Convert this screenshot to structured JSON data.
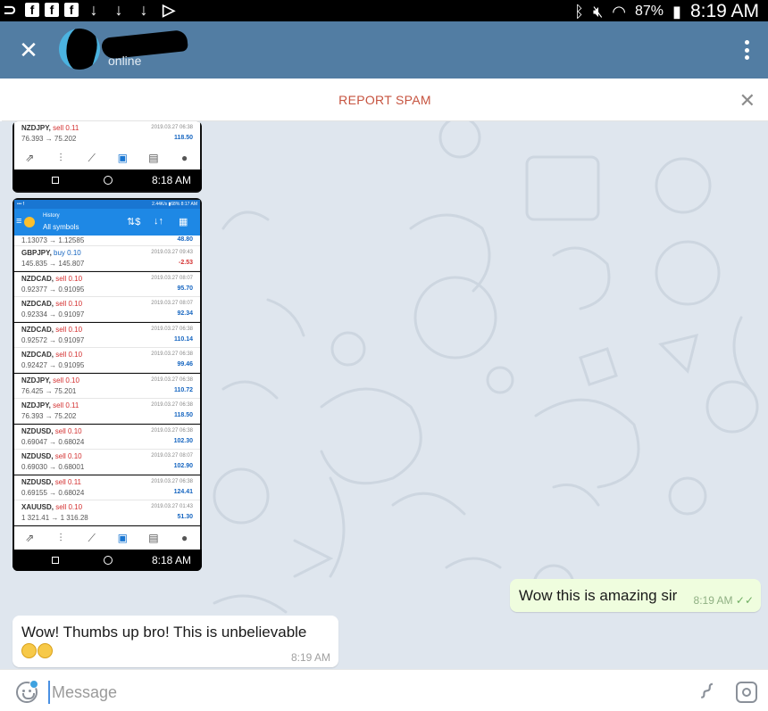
{
  "status_bar": {
    "battery": "87%",
    "time": "8:19 AM"
  },
  "header": {
    "close_icon": "close-icon",
    "status": "online",
    "menu_icon": "more-vertical-icon"
  },
  "spam_bar": {
    "label": "REPORT SPAM",
    "close_icon": "close-icon"
  },
  "photo_1": {
    "rows": [
      {
        "symbol": "NZDJPY,",
        "side": "sell 0.11",
        "prices": "76.393 → 75.202",
        "date": "2019.03.27 06:38",
        "profit": "118.50"
      }
    ],
    "nav_time": "8:18 AM"
  },
  "photo_2": {
    "status_left": "••• f",
    "status_right": "2.44K/s  ▮68% 8:17 AM",
    "title": "History",
    "subtitle": "All symbols",
    "partial_row": {
      "prices": "1.13073 → 1.12585",
      "profit": "48.80"
    },
    "rows": [
      {
        "symbol": "GBPJPY,",
        "side": "buy 0.10",
        "side_type": "buy",
        "prices": "145.835 → 145.807",
        "date": "2019.03.27 09:43",
        "profit": "-2.53",
        "neg": true
      },
      {
        "symbol": "NZDCAD,",
        "side": "sell 0.10",
        "side_type": "sell",
        "prices": "0.92377 → 0.91095",
        "date": "2019.03.27 08:07",
        "profit": "95.70",
        "neg": false
      },
      {
        "symbol": "NZDCAD,",
        "side": "sell 0.10",
        "side_type": "sell",
        "prices": "0.92334 → 0.91097",
        "date": "2019.03.27 08:07",
        "profit": "92.34",
        "neg": false
      },
      {
        "symbol": "NZDCAD,",
        "side": "sell 0.10",
        "side_type": "sell",
        "prices": "0.92572 → 0.91097",
        "date": "2019.03.27 06:38",
        "profit": "110.14",
        "neg": false
      },
      {
        "symbol": "NZDCAD,",
        "side": "sell 0.10",
        "side_type": "sell",
        "prices": "0.92427 → 0.91095",
        "date": "2019.03.27 06:38",
        "profit": "99.46",
        "neg": false
      },
      {
        "symbol": "NZDJPY,",
        "side": "sell 0.10",
        "side_type": "sell",
        "prices": "76.425 → 75.201",
        "date": "2019.03.27 06:38",
        "profit": "110.72",
        "neg": false
      },
      {
        "symbol": "NZDJPY,",
        "side": "sell 0.11",
        "side_type": "sell",
        "prices": "76.393 → 75.202",
        "date": "2019.03.27 06:38",
        "profit": "118.50",
        "neg": false
      },
      {
        "symbol": "NZDUSD,",
        "side": "sell 0.10",
        "side_type": "sell",
        "prices": "0.69047 → 0.68024",
        "date": "2019.03.27 06:38",
        "profit": "102.30",
        "neg": false
      },
      {
        "symbol": "NZDUSD,",
        "side": "sell 0.10",
        "side_type": "sell",
        "prices": "0.69030 → 0.68001",
        "date": "2019.03.27 08:07",
        "profit": "102.90",
        "neg": false
      },
      {
        "symbol": "NZDUSD,",
        "side": "sell 0.11",
        "side_type": "sell",
        "prices": "0.69155 → 0.68024",
        "date": "2019.03.27 06:38",
        "profit": "124.41",
        "neg": false
      },
      {
        "symbol": "XAUUSD,",
        "side": "sell 0.10",
        "side_type": "sell",
        "prices": "1 321.41 → 1 316.28",
        "date": "2019.03.27 01:43",
        "profit": "51.30",
        "neg": false
      }
    ],
    "nav_time": "8:18 AM"
  },
  "messages": {
    "outgoing": {
      "text": "Wow this is amazing sir",
      "time": "8:19 AM"
    },
    "incoming": {
      "text": "Wow! Thumbs up bro! This is unbelievable",
      "time": "8:19 AM"
    }
  },
  "composer": {
    "placeholder": "Message"
  },
  "colors": {
    "header": "#527da3",
    "spam": "#c6533f",
    "chat_bg": "#dfe6ee",
    "outgoing_bubble": "#effdde",
    "read_check": "#6fae62"
  }
}
